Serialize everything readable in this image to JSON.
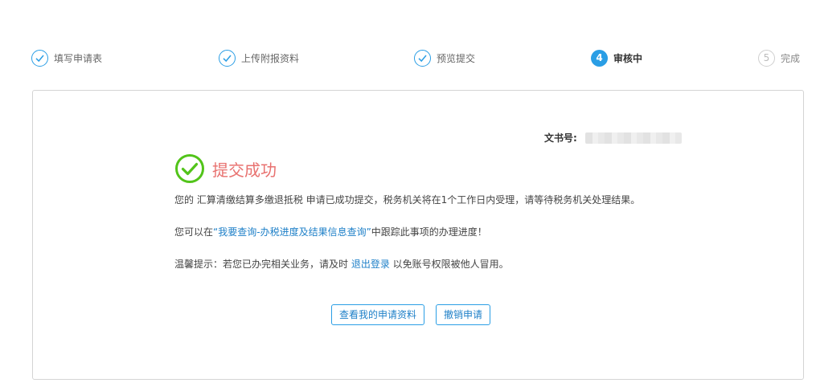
{
  "steps": [
    {
      "label": "填写申请表",
      "status": "done"
    },
    {
      "label": "上传附报资料",
      "status": "done"
    },
    {
      "label": "预览提交",
      "status": "done"
    },
    {
      "label": "审核中",
      "status": "active",
      "number": "4"
    },
    {
      "label": "完成",
      "status": "todo",
      "number": "5"
    }
  ],
  "card": {
    "doc_label": "文书号:",
    "title": "提交成功",
    "message1": "您的 汇算清缴结算多缴退抵税 申请已成功提交，税务机关将在1个工作日内受理，请等待税务机关处理结果。",
    "message2_prefix": "您可以在",
    "message2_link": "“我要查询-办税进度及结果信息查询”",
    "message2_suffix": "中跟踪此事项的办理进度！",
    "message3_prefix": "温馨提示：若您已办完相关业务，请及时 ",
    "message3_link": "退出登录",
    "message3_suffix": " 以免账号权限被他人冒用。",
    "btn_view": "查看我的申请资料",
    "btn_cancel": "撤销申请"
  },
  "colors": {
    "accent": "#2a9ee5",
    "success_green": "#52c41a",
    "success_title": "#e8716f",
    "link": "#1f80c8"
  }
}
